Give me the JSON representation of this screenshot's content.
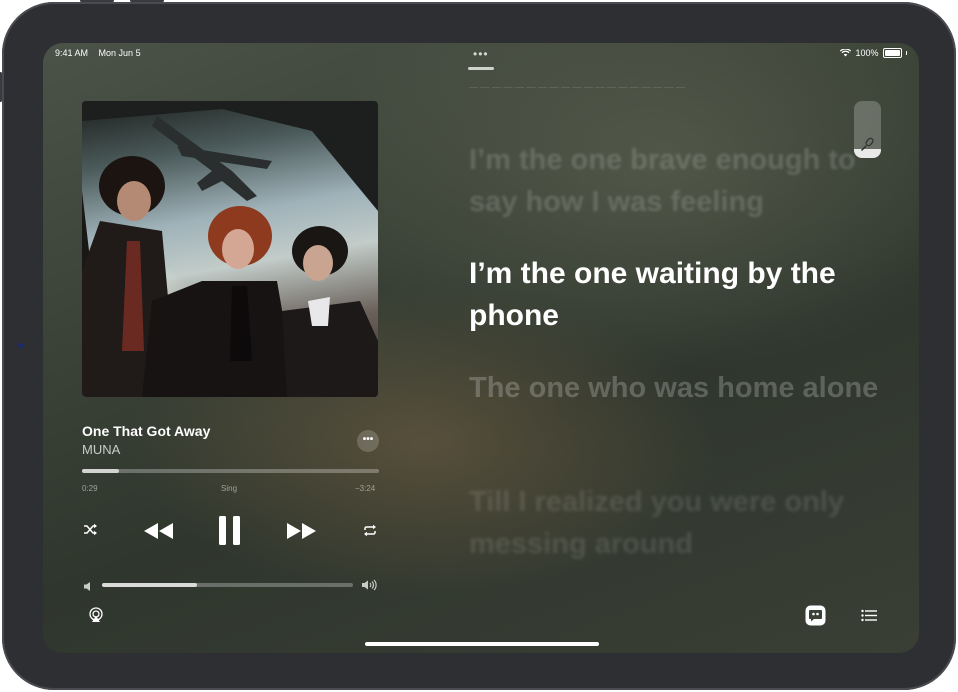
{
  "status_bar": {
    "time": "9:41 AM",
    "date": "Mon Jun 5",
    "battery": "100%"
  },
  "now_playing": {
    "title": "One That Got Away",
    "artist": "MUNA",
    "elapsed": "0:29",
    "remaining": "−3:24",
    "mode_label": "Sing",
    "progress_fraction": 0.125,
    "volume_fraction": 0.38
  },
  "lyrics": {
    "previous": "I’m the one brave enough to say how I was feeling",
    "current": "I’m the one waiting by the phone",
    "next": "The one who was home alone",
    "upcoming": "Till I realized you were only messing around"
  },
  "icons": {
    "more": "more-icon",
    "shuffle": "shuffle-icon",
    "previous": "previous-icon",
    "pause": "pause-icon",
    "next": "next-icon",
    "repeat": "repeat-icon",
    "volume_low": "volume-low-icon",
    "volume_high": "volume-high-icon",
    "airplay": "airplay-icon",
    "lyrics": "lyrics-icon",
    "queue": "queue-icon",
    "vocal": "microphone-icon"
  },
  "colors": {
    "accent": "#ffffff",
    "background": "#3a4136"
  }
}
